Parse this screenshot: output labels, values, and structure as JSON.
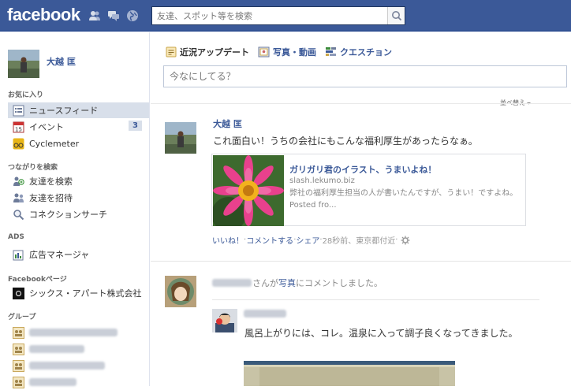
{
  "header": {
    "logo_text": "facebook",
    "search_placeholder": "友達、スポット等を検索",
    "brand_color": "#3b5998",
    "icons": [
      "friend-requests-icon",
      "messages-icon",
      "notifications-globe-icon",
      "search-icon"
    ]
  },
  "sidebar": {
    "profile_name": "大越 匡",
    "sections": {
      "favorites": "お気に入り",
      "connect": "つながりを検索",
      "ads": "ADS",
      "pages": "Facebookページ",
      "groups": "グループ"
    },
    "favorites": [
      {
        "label": "ニュースフィード",
        "icon": "news-feed-icon"
      },
      {
        "label": "イベント",
        "icon": "calendar-icon",
        "count": "3"
      },
      {
        "label": "Cyclemeter",
        "icon": "app-icon"
      }
    ],
    "connect": [
      {
        "label": "友達を検索",
        "icon": "friends-icon"
      },
      {
        "label": "友達を招待",
        "icon": "invite-friends-icon"
      },
      {
        "label": "コネクションサーチ",
        "icon": "magnifier-icon"
      }
    ],
    "ads": [
      {
        "label": "広告マネージャ",
        "icon": "ads-manager-icon"
      }
    ],
    "pages": [
      {
        "label": "シックス・アパート株式会社",
        "icon": "page-logo-icon"
      }
    ]
  },
  "composer": {
    "tabs": [
      {
        "label": "近況アップデート",
        "icon": "status-icon"
      },
      {
        "label": "写真・動画",
        "icon": "photo-icon"
      },
      {
        "label": "クエスチョン",
        "icon": "question-icon"
      }
    ],
    "placeholder": "今なにしてる？"
  },
  "feed": {
    "sort_label": "並べ替え",
    "post1": {
      "author": "大越 匡",
      "text": "これ面白い！うちの会社にもこんな福利厚生があったらなぁ。",
      "attachment": {
        "title": "ガリガリ君のイラスト、うまいよね！",
        "domain": "slash.lekumo.biz",
        "description": "弊社の福利厚生担当の人が書いたんですが、うまい！ですよね。 Posted fro..."
      },
      "meta": {
        "like": "いいね！",
        "comment": "コメントする",
        "share": "シェア",
        "time_location": "28秒前、東京都付近",
        "sep": " · "
      }
    },
    "post2": {
      "action_prefix": "さんが",
      "photo_link": "写真",
      "action_suffix": "にコメントしました。",
      "comment_text": "風呂上がりには、コレ。温泉に入って調子良くなってきました。"
    }
  }
}
